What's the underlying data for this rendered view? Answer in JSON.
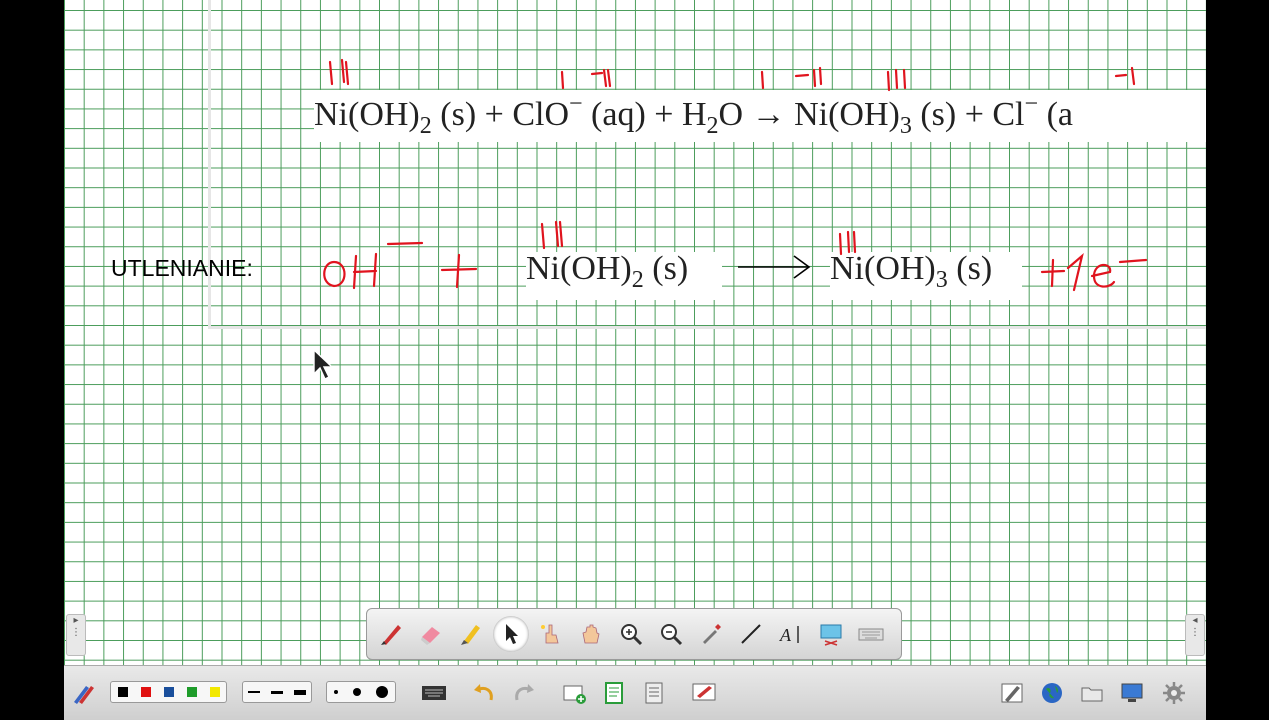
{
  "whiteboard": {
    "equation_top": {
      "ni_reactant": "Ni(OH)",
      "ni_reactant_sub": "2",
      "s1": " (s) + ClO",
      "s1_sup": "−",
      "aq1": " (aq) + H",
      "h2o_sub": "2",
      "o_arrow": "O → Ni(OH)",
      "ni_product_sub": "3",
      "s2": " (s) + Cl",
      "cl_sup": "−",
      "aq2": " (a"
    },
    "equation_left": {
      "text": "Ni(OH)",
      "sub": "2",
      "state": " (s)"
    },
    "equation_right": {
      "text": "Ni(OH)",
      "sub": "3",
      "state": " (s)"
    },
    "oxidation_label": "UTLENIANIE:",
    "handwriting": {
      "color": "#e0141e",
      "oh": "OH",
      "plus": "+",
      "electron": "+1e",
      "ox_ni_II": "II",
      "ox_cl_I": "I",
      "ox_o_II": "-II",
      "ox_h_I": "I",
      "ox_o2_II": "-II",
      "ox_ni_III": "III",
      "ox_cl_minus_I": "-I"
    }
  },
  "toolbar": {
    "tools": [
      {
        "name": "pen-tool",
        "icon": "pen-icon",
        "active": false
      },
      {
        "name": "eraser-tool",
        "icon": "eraser-icon",
        "active": false
      },
      {
        "name": "highlighter-tool",
        "icon": "highlighter-icon",
        "active": false
      },
      {
        "name": "select-tool",
        "icon": "cursor-arrow-icon",
        "active": true
      },
      {
        "name": "magic-pointer-tool",
        "icon": "magic-hand-icon",
        "active": false
      },
      {
        "name": "pan-tool",
        "icon": "hand-icon",
        "active": false
      },
      {
        "name": "zoom-in-tool",
        "icon": "zoom-in-icon",
        "active": false
      },
      {
        "name": "zoom-out-tool",
        "icon": "zoom-out-icon",
        "active": false
      },
      {
        "name": "pick-color-tool",
        "icon": "eyedropper-icon",
        "active": false
      },
      {
        "name": "line-tool",
        "icon": "line-icon",
        "active": false
      },
      {
        "name": "text-tool",
        "icon": "text-icon",
        "active": false
      },
      {
        "name": "screen-capture-tool",
        "icon": "screen-capture-icon",
        "active": false
      },
      {
        "name": "keyboard-tool",
        "icon": "keyboard-icon",
        "active": false
      }
    ]
  },
  "bottom_bar": {
    "colors": [
      "#000000",
      "#e01010",
      "#1a4f9c",
      "#1e9c2a",
      "#f2e800"
    ],
    "right_items": [
      "pen-settings-icon",
      "globe-icon",
      "folder-icon",
      "display-icon",
      "settings-gear-icon"
    ]
  }
}
